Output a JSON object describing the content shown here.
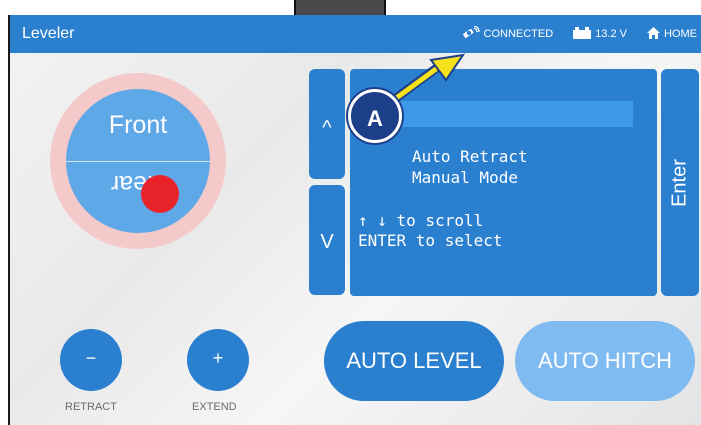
{
  "titlebar": {
    "title": "Leveler",
    "connection_label": "CONNECTED",
    "voltage": "13.2 V",
    "home_label": "HOME",
    "connection_icon": "satellite-icon",
    "battery_icon": "battery-icon",
    "home_icon": "home-icon"
  },
  "dial": {
    "front_label": "Front",
    "rear_label": "Rear"
  },
  "scroll": {
    "up_glyph": "^",
    "down_glyph": "V"
  },
  "lcd": {
    "line1": "Auto Retract",
    "line2": "Manual Mode",
    "line3": "↑ ↓ to scroll",
    "line4": "ENTER to select"
  },
  "enter_label": "Enter",
  "jack": {
    "retract_glyph": "−",
    "extend_glyph": "+",
    "retract_label": "RETRACT",
    "extend_label": "EXTEND"
  },
  "actions": {
    "auto_level": "AUTO LEVEL",
    "auto_hitch": "AUTO HITCH"
  },
  "callout": {
    "label": "A",
    "color": "#1d3f8a",
    "arrow_color": "#f5e21a"
  },
  "colors": {
    "accent": "#2a7fcf",
    "bubble": "#e8242a",
    "dial": "#5fa8e8",
    "dial_ring": "#f4c9c9",
    "disabled": "#7fbaf0"
  }
}
